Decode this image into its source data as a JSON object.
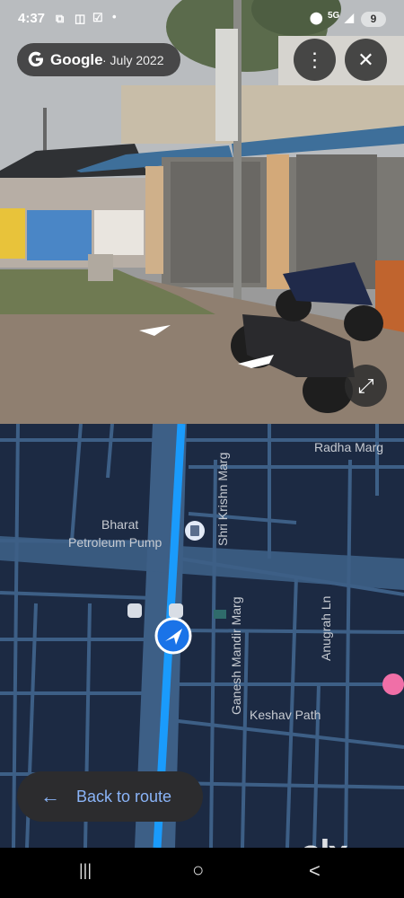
{
  "status_bar": {
    "time": "4:37",
    "icons": [
      "screenshot-icon",
      "cast-icon",
      "check-icon",
      "dot-icon",
      "location-icon",
      "5g-icon",
      "signal-icon"
    ],
    "signal_label": "5G",
    "battery": "9"
  },
  "street_view": {
    "brand": "Google",
    "date": "· July 2022",
    "more_icon": "⋮",
    "close_icon": "✕",
    "expand_icon": "⤢",
    "colors": {
      "sky": "#b9bcbf",
      "ground": "#8f7f70",
      "awning": "#3e6f9a"
    }
  },
  "map": {
    "labels": {
      "radha_marg": "Radha Marg",
      "shri_krishn_marg": "Shri Krishn Marg",
      "bharat_line1": "Bharat",
      "bharat_line2": "Petroleum Pump",
      "ganesh_mandir_marg": "Ganesh Mandir Marg",
      "anugrah_ln": "Anugrah Ln",
      "keshav_path": "Keshav Path"
    },
    "colors": {
      "background": "#1c2a43",
      "road": "#3d5f86",
      "route": "#1a9bfc",
      "accent": "#8ab4f8"
    },
    "back_to_route": {
      "icon": "←",
      "label": "Back to route"
    }
  },
  "nav_bar": {
    "recent": "|||",
    "home": "○",
    "back": "<"
  },
  "watermark": "olx"
}
